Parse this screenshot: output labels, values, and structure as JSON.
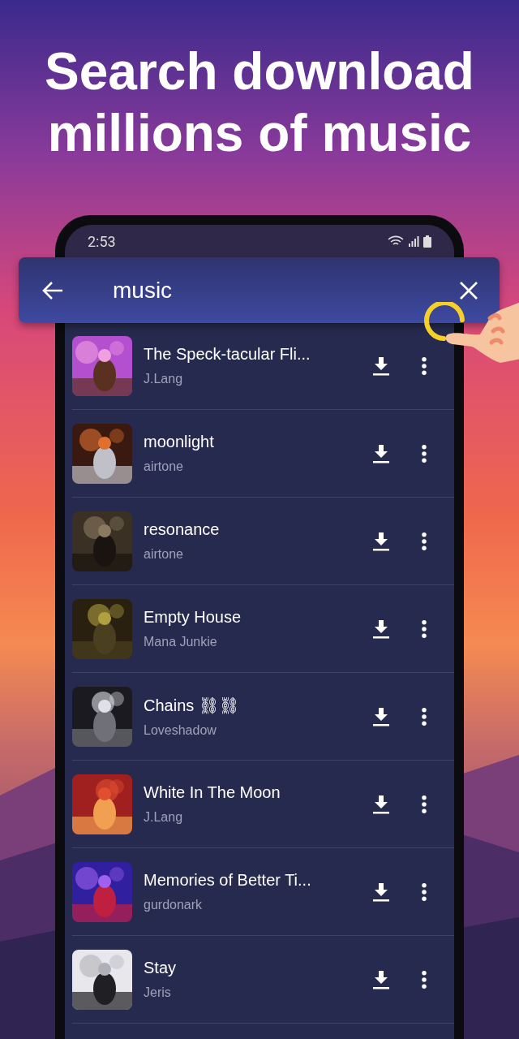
{
  "headline": "Search download millions of music",
  "status_bar": {
    "time": "2:53"
  },
  "search": {
    "value": "music"
  },
  "results": [
    {
      "title": "The Speck-tacular Fli...",
      "artist": "J.Lang"
    },
    {
      "title": "moonlight",
      "artist": "airtone"
    },
    {
      "title": "resonance",
      "artist": "airtone"
    },
    {
      "title": "Empty House",
      "artist": "Mana Junkie"
    },
    {
      "title": "Chains ⛓⛓",
      "artist": "Loveshadow"
    },
    {
      "title": "White In The Moon",
      "artist": "J.Lang"
    },
    {
      "title": "Memories of Better Ti...",
      "artist": "gurdonark"
    },
    {
      "title": "Stay",
      "artist": "Jeris"
    }
  ]
}
